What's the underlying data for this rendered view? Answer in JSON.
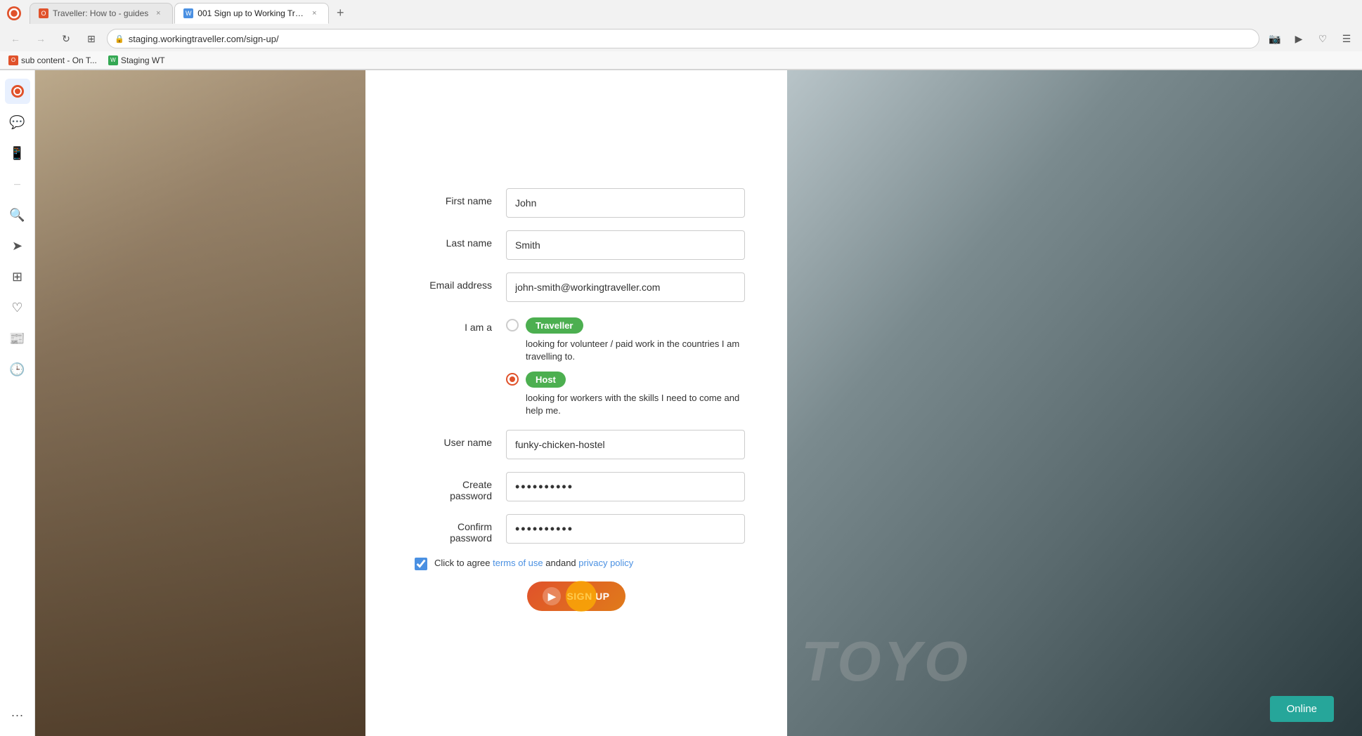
{
  "browser": {
    "tabs": [
      {
        "id": "tab1",
        "label": "Traveller: How to - guides",
        "favicon_type": "opera",
        "active": false
      },
      {
        "id": "tab2",
        "label": "001 Sign up to Working Tra...",
        "favicon_type": "blue",
        "active": true
      }
    ],
    "new_tab_label": "+",
    "address": "staging.workingtraveller.com/sign-up/",
    "bookmarks": [
      {
        "label": "sub content - On T...",
        "favicon_type": "opera"
      },
      {
        "label": "Staging WT",
        "favicon_type": "green"
      }
    ]
  },
  "sidebar": {
    "icons": [
      {
        "name": "opera-logo",
        "symbol": "O",
        "active": true
      },
      {
        "name": "back-icon",
        "symbol": "←",
        "active": false
      },
      {
        "name": "search-icon",
        "symbol": "🔍",
        "active": false
      },
      {
        "name": "send-icon",
        "symbol": "➤",
        "active": false
      },
      {
        "name": "apps-icon",
        "symbol": "⊞",
        "active": false
      },
      {
        "name": "heart-icon",
        "symbol": "♡",
        "active": false
      },
      {
        "name": "news-icon",
        "symbol": "📰",
        "active": false
      },
      {
        "name": "history-icon",
        "symbol": "🕒",
        "active": false
      },
      {
        "name": "more-icon",
        "symbol": "···",
        "active": false
      }
    ]
  },
  "form": {
    "first_name_label": "First name",
    "first_name_value": "John",
    "last_name_label": "Last name",
    "last_name_value": "Smith",
    "email_label": "Email address",
    "email_value": "john-smith@workingtraveller.com",
    "role_label": "I am a",
    "roles": [
      {
        "id": "traveller",
        "badge": "Traveller",
        "description": "looking for volunteer / paid work in the countries I am travelling to.",
        "checked": false
      },
      {
        "id": "host",
        "badge": "Host",
        "description": "looking for workers with the skills I need to come and help me.",
        "checked": true
      }
    ],
    "username_label": "User name",
    "username_value": "funky-chicken-hostel",
    "password_label": "Create\npassword",
    "password_value": "••••••••••",
    "confirm_label": "Confirm\npassword",
    "confirm_value": "••••••••••",
    "terms_text": "Click to agree",
    "terms_link": "terms of use",
    "and_text": "and",
    "privacy_link": "privacy policy",
    "signup_button": "SIGN UP"
  },
  "online_badge": {
    "label": "Online"
  },
  "bg_right_text": "TOYO"
}
